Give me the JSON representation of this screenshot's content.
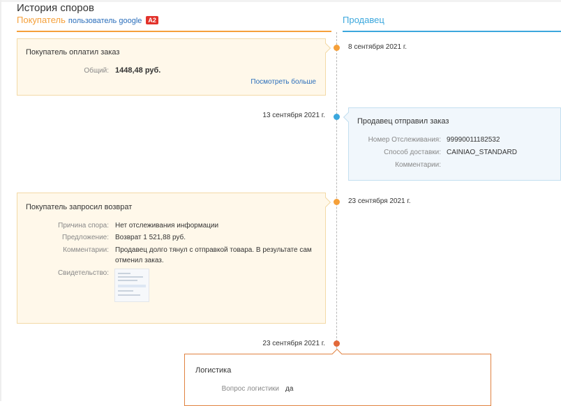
{
  "page": {
    "title": "История споров"
  },
  "columns": {
    "buyer_label": "Покупатель",
    "buyer_user": "пользователь google",
    "buyer_badge": "A2",
    "seller_label": "Продавец"
  },
  "events": {
    "payment": {
      "date": "8 сентября 2021 г.",
      "title": "Покупатель оплатил заказ",
      "total_label": "Общий:",
      "total_value": "1448,48 руб.",
      "more_link": "Посмотреть больше"
    },
    "shipment": {
      "date": "13 сентября 2021 г.",
      "title": "Продавец отправил заказ",
      "tracking_label": "Номер Отслеживания:",
      "tracking_value": "99990011182532",
      "delivery_label": "Способ доставки:",
      "delivery_value": "CAINIAO_STANDARD",
      "comments_label": "Комментарии:"
    },
    "refund": {
      "date": "23 сентября 2021 г.",
      "title": "Покупатель запросил возврат",
      "reason_label": "Причина спора:",
      "reason_value": "Нет отслеживания информации",
      "offer_label": "Предложение:",
      "offer_value": "Возврат 1 521,88 руб.",
      "comments_label": "Комментарии:",
      "comments_value": "Продавец долго тянул с отправкой товара. В результате сам отменил заказ.",
      "evidence_label": "Свидетельство:"
    },
    "logistics": {
      "date": "23 сентября 2021 г.",
      "title": "Логистика",
      "question_label": "Вопрос логистики",
      "question_value": "да"
    }
  },
  "colors": {
    "buyer": "#f5a03a",
    "seller": "#3ba7dd",
    "logistics": "#e2693a",
    "link": "#2a6ebb",
    "badge": "#e2322b"
  }
}
